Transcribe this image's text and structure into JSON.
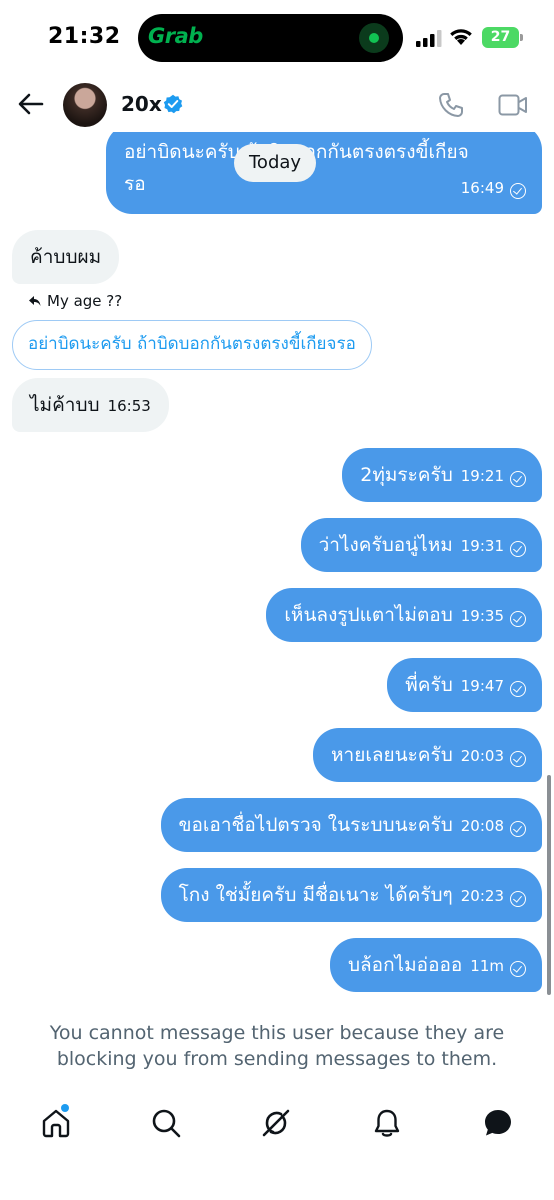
{
  "status_bar": {
    "time": "21:32",
    "battery": "27",
    "island_app": "Grab"
  },
  "header": {
    "name": "20x"
  },
  "chat": {
    "date_separator": "Today",
    "messages": [
      {
        "direction": "out",
        "text_line1": "อย่าบิดนะครับ ถ้าบิดบอกกันตรงตรงขี้เกียจ",
        "text_line2": "รอ",
        "time": "16:49"
      },
      {
        "direction": "in",
        "text": "ค้าบบผม"
      },
      {
        "direction": "in",
        "reply_label": "My age ??",
        "quote": "อย่าบิดนะครับ ถ้าบิดบอกกันตรงตรงขี้เกียจรอ",
        "text": "ไม่ค้าบบ",
        "time": "16:53"
      },
      {
        "direction": "out",
        "text": "2ทุ่มระครับ",
        "time": "19:21"
      },
      {
        "direction": "out",
        "text": "ว่าไงครับอนู่ไหม",
        "time": "19:31"
      },
      {
        "direction": "out",
        "text": "เห็นลงรูปแตาไม่ตอบ",
        "time": "19:35"
      },
      {
        "direction": "out",
        "text": "พี่ครับ",
        "time": "19:47"
      },
      {
        "direction": "out",
        "text": "หายเลยนะครับ",
        "time": "20:03"
      },
      {
        "direction": "out",
        "text": "ขอเอาชื่อไปตรวจ ในระบบนะครับ",
        "time": "20:08"
      },
      {
        "direction": "out",
        "text": "โกง ใช่มั้ยครับ มีชื่อเนาะ ได้ครับๆ",
        "time": "20:23"
      },
      {
        "direction": "out",
        "text": "บล้อกไมอ่อออ",
        "time": "11m"
      }
    ]
  },
  "notice": {
    "line1": "You cannot message this user because they are",
    "line2": "blocking you from sending messages to them."
  },
  "colors": {
    "accent": "#1d9bf0",
    "bubble_out": "#4a99e9",
    "bubble_in": "#eff3f4"
  },
  "nav": {
    "items": [
      "home-icon",
      "search-icon",
      "grok-icon",
      "notifications-icon",
      "messages-icon"
    ]
  }
}
